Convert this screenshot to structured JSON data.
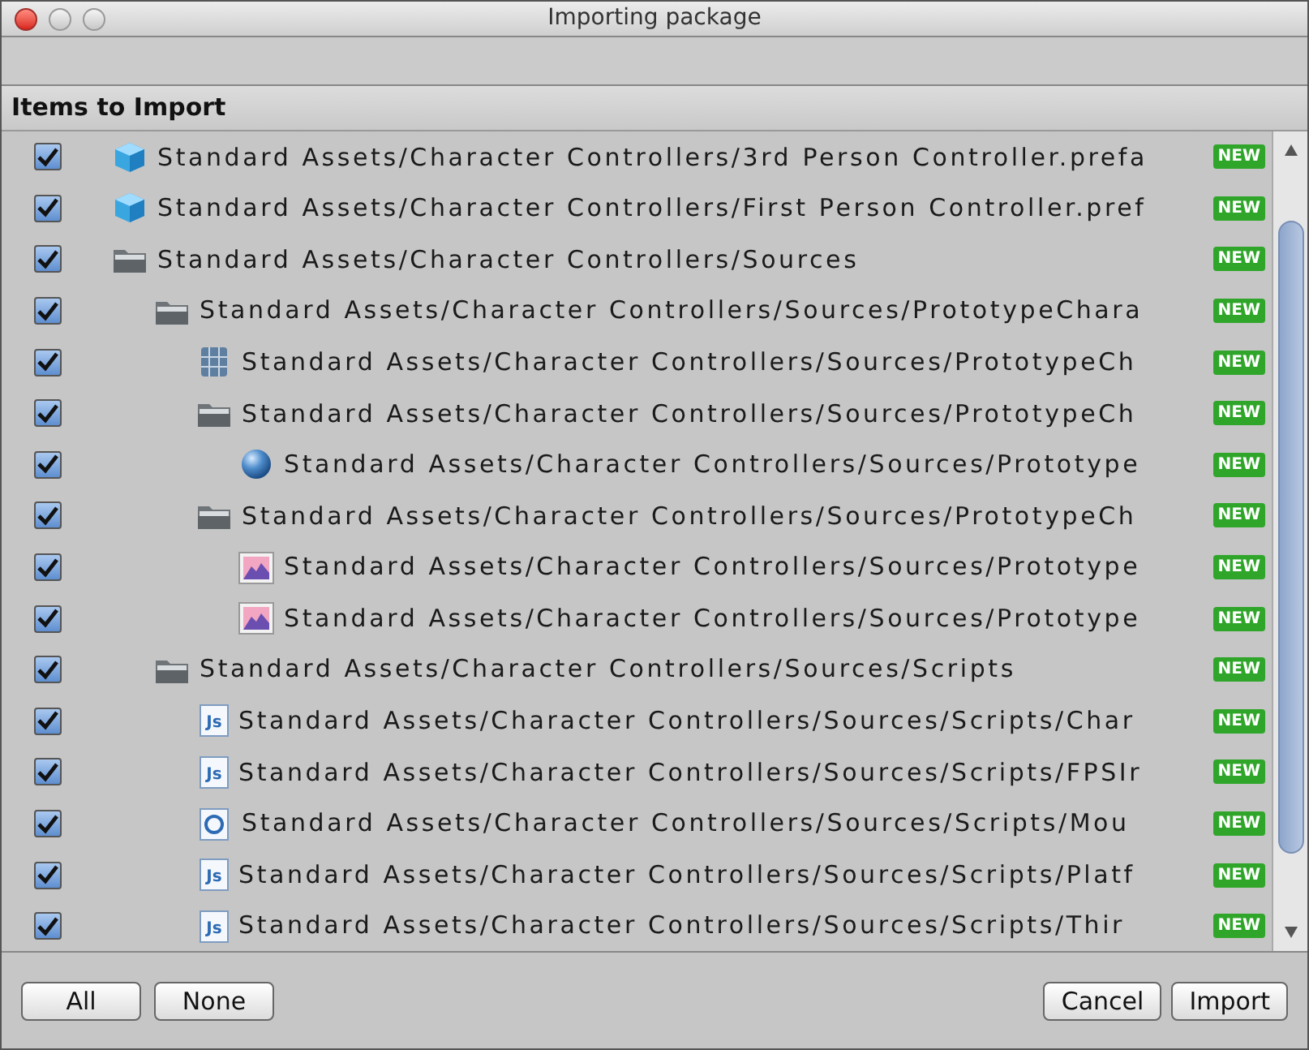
{
  "window": {
    "title": "Importing package"
  },
  "header": "Items to Import",
  "items": [
    {
      "label": "Standard Assets/Character Controllers/3rd Person Controller.prefa",
      "kind": "prefab",
      "checked": true,
      "badge": "NEW"
    },
    {
      "label": "Standard Assets/Character Controllers/First Person Controller.pref",
      "kind": "prefab",
      "checked": true,
      "badge": "NEW"
    },
    {
      "label": "Standard Assets/Character Controllers/Sources",
      "kind": "folder",
      "checked": true,
      "badge": "NEW",
      "children": [
        {
          "label": "Standard Assets/Character Controllers/Sources/PrototypeChara",
          "kind": "folder",
          "checked": true,
          "badge": "NEW",
          "children": [
            {
              "label": "Standard Assets/Character Controllers/Sources/PrototypeCh",
              "kind": "mesh",
              "checked": true,
              "badge": "NEW"
            },
            {
              "label": "Standard Assets/Character Controllers/Sources/PrototypeCh",
              "kind": "folder",
              "checked": true,
              "badge": "NEW",
              "children": [
                {
                  "label": "Standard Assets/Character Controllers/Sources/Prototype",
                  "kind": "material",
                  "checked": true,
                  "badge": "NEW"
                }
              ]
            },
            {
              "label": "Standard Assets/Character Controllers/Sources/PrototypeCh",
              "kind": "folder",
              "checked": true,
              "badge": "NEW",
              "children": [
                {
                  "label": "Standard Assets/Character Controllers/Sources/Prototype",
                  "kind": "texture",
                  "checked": true,
                  "badge": "NEW"
                },
                {
                  "label": "Standard Assets/Character Controllers/Sources/Prototype",
                  "kind": "texture",
                  "checked": true,
                  "badge": "NEW"
                }
              ]
            }
          ]
        },
        {
          "label": "Standard Assets/Character Controllers/Sources/Scripts",
          "kind": "folder",
          "checked": true,
          "badge": "NEW",
          "children": [
            {
              "label": "Standard Assets/Character Controllers/Sources/Scripts/Char",
              "kind": "js",
              "icon_text": "Js",
              "checked": true,
              "badge": "NEW"
            },
            {
              "label": "Standard Assets/Character Controllers/Sources/Scripts/FPSIr",
              "kind": "js",
              "icon_text": "Js",
              "checked": true,
              "badge": "NEW"
            },
            {
              "label": "Standard Assets/Character Controllers/Sources/Scripts/Mou",
              "kind": "cs",
              "checked": true,
              "badge": "NEW"
            },
            {
              "label": "Standard Assets/Character Controllers/Sources/Scripts/Platf",
              "kind": "js",
              "icon_text": "Js",
              "checked": true,
              "badge": "NEW"
            },
            {
              "label": "Standard Assets/Character Controllers/Sources/Scripts/Thir",
              "kind": "js",
              "icon_text": "Js",
              "checked": true,
              "badge": "NEW"
            }
          ]
        }
      ]
    }
  ],
  "left_buttons": [
    "All",
    "None"
  ],
  "right_buttons": [
    "Cancel",
    "Import"
  ]
}
